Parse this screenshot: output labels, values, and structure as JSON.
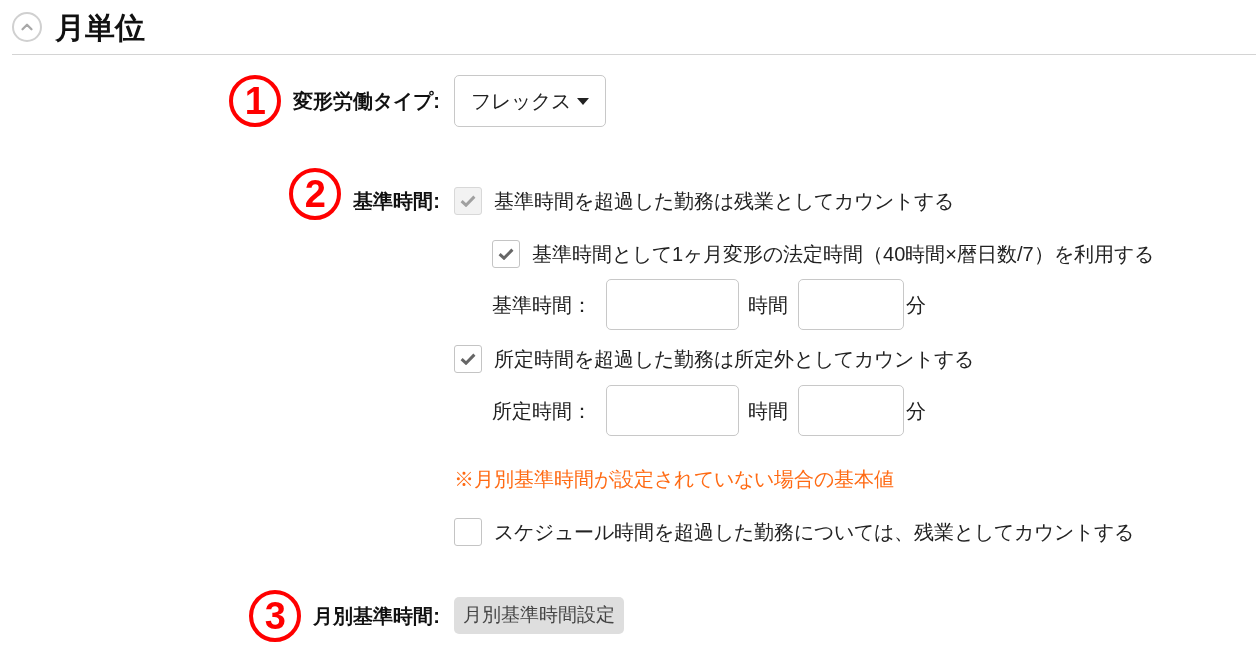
{
  "section": {
    "title": "月単位",
    "expanded": true
  },
  "rows": [
    {
      "kind": "select",
      "number": "1",
      "label": "変形労働タイプ:",
      "value": "フレックス"
    },
    {
      "kind": "options",
      "number": "2",
      "label": "基準時間:",
      "items": [
        {
          "kind": "checkbox",
          "label": "基準時間を超過した勤務は残業としてカウントする",
          "checked": true,
          "disabled": true,
          "children": [
            {
              "kind": "checkbox",
              "label": "基準時間として1ヶ月変形の法定時間（40時間×暦日数/7）を利用する",
              "checked": true,
              "disabled": false
            },
            {
              "kind": "time",
              "label": "基準時間：",
              "hours_unit": "時間",
              "minutes_unit": "分"
            }
          ]
        },
        {
          "kind": "checkbox",
          "label": "所定時間を超過した勤務は所定外としてカウントする",
          "checked": true,
          "disabled": false,
          "children": [
            {
              "kind": "time",
              "label": "所定時間：",
              "hours_unit": "時間",
              "minutes_unit": "分"
            }
          ]
        },
        {
          "kind": "note",
          "text": "※月別基準時間が設定されていない場合の基本値"
        },
        {
          "kind": "checkbox",
          "label": "スケジュール時間を超過した勤務については、残業としてカウントする",
          "checked": false,
          "disabled": false
        }
      ]
    },
    {
      "kind": "button",
      "number": "3",
      "label": "月別基準時間:",
      "button": "月別基準時間設定"
    }
  ]
}
